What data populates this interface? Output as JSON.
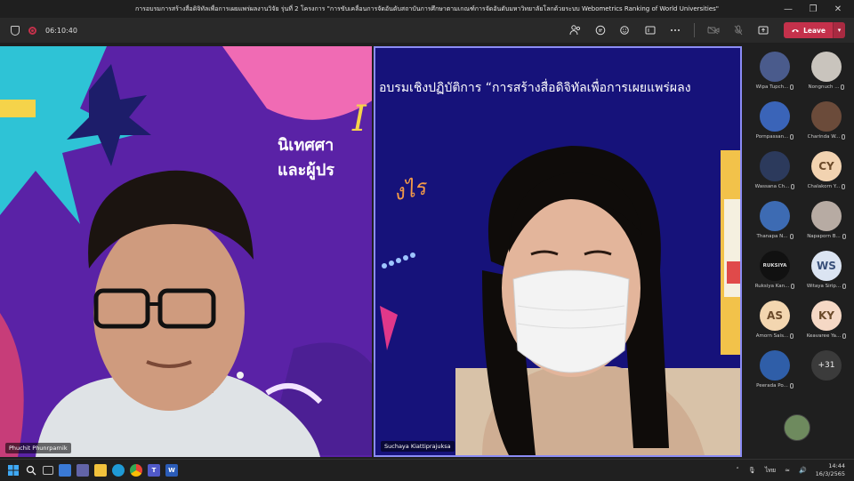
{
  "window": {
    "title": "การอบรมการสร้างสื่อดิจิทัลเพื่อการเผยแพร่ผลงานวิจัย รุ่นที่ 2 โครงการ \"การขับเคลื่อนการจัดอันดับสถาบันการศึกษาตามเกณฑ์การจัดอันดับมหาวิทยาลัยโลกด้วยระบบ Webometrics Ranking of World Universities\"",
    "controls": {
      "minimize": "—",
      "maximize": "❐",
      "close": "✕"
    }
  },
  "toolbar": {
    "timer": "06:10:40",
    "leave_label": "Leave"
  },
  "tiles": {
    "left": {
      "name": "Phuchit Phunrparnik",
      "slide_text_line1": "นิเทศศา",
      "slide_text_line2": "และผู้ปร"
    },
    "right": {
      "name": "Suchaya Kiattiprajuksa",
      "slide_banner": "อบรมเชิงปฏิบัติการ “การสร้างสื่อดิจิทัลเพื่อการเผยแพร่ผลง",
      "slide_orange": "งไร"
    }
  },
  "roster": {
    "people": [
      {
        "name": "Wipa Tupch...",
        "initials": "",
        "bg": "#4a5b8c"
      },
      {
        "name": "Nongnuch ...",
        "initials": "",
        "bg": "#c9c4bd"
      },
      {
        "name": "Pornpassan...",
        "initials": "",
        "bg": "#3a64b8"
      },
      {
        "name": "Charinda W...",
        "initials": "",
        "bg": "#6b4b3a"
      },
      {
        "name": "Wassana Ch...",
        "initials": "",
        "bg": "#2c3a5c"
      },
      {
        "name": "Chalakorn Y...",
        "initials": "CY",
        "bg": "#f2d3b1",
        "fg": "#6b4a2a"
      },
      {
        "name": "Thanapa N...",
        "initials": "",
        "bg": "#3d6bb3"
      },
      {
        "name": "Napaporn B...",
        "initials": "",
        "bg": "#b7aba3"
      },
      {
        "name": "Ruksiya Kan...",
        "initials": "RUKSIYA",
        "bg": "#111111",
        "fg": "#dddddd"
      },
      {
        "name": "Witaya Sirip...",
        "initials": "WS",
        "bg": "#dbe4f2",
        "fg": "#39507a"
      },
      {
        "name": "Amorn Sais...",
        "initials": "AS",
        "bg": "#f3d6b0",
        "fg": "#6b4a2a"
      },
      {
        "name": "Keavaree Ya...",
        "initials": "KY",
        "bg": "#f5d8c5",
        "fg": "#6b4a2a"
      },
      {
        "name": "Peerada Po...",
        "initials": "",
        "bg": "#2f5ea8"
      }
    ],
    "more": "+31"
  },
  "taskbar": {
    "lang": "ไทย",
    "time": "14:44",
    "date": "16/3/2565"
  }
}
